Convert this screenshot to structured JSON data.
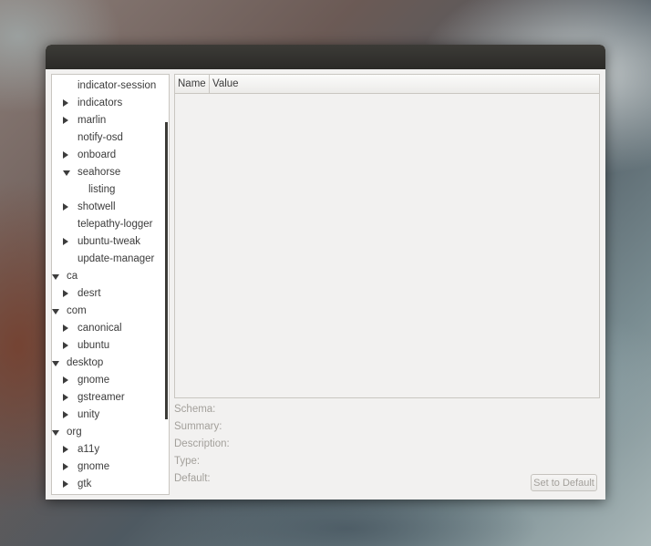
{
  "tree": {
    "items": [
      {
        "label": "indicator-session",
        "level": 2,
        "expander": "none"
      },
      {
        "label": "indicators",
        "level": 2,
        "expander": "collapsed"
      },
      {
        "label": "marlin",
        "level": 2,
        "expander": "collapsed"
      },
      {
        "label": "notify-osd",
        "level": 2,
        "expander": "none"
      },
      {
        "label": "onboard",
        "level": 2,
        "expander": "collapsed"
      },
      {
        "label": "seahorse",
        "level": 2,
        "expander": "expanded"
      },
      {
        "label": "listing",
        "level": 3,
        "expander": "none"
      },
      {
        "label": "shotwell",
        "level": 2,
        "expander": "collapsed"
      },
      {
        "label": "telepathy-logger",
        "level": 2,
        "expander": "none"
      },
      {
        "label": "ubuntu-tweak",
        "level": 2,
        "expander": "collapsed"
      },
      {
        "label": "update-manager",
        "level": 2,
        "expander": "none"
      },
      {
        "label": "ca",
        "level": 1,
        "expander": "expanded"
      },
      {
        "label": "desrt",
        "level": 2,
        "expander": "collapsed"
      },
      {
        "label": "com",
        "level": 1,
        "expander": "expanded"
      },
      {
        "label": "canonical",
        "level": 2,
        "expander": "collapsed"
      },
      {
        "label": "ubuntu",
        "level": 2,
        "expander": "collapsed"
      },
      {
        "label": "desktop",
        "level": 1,
        "expander": "expanded"
      },
      {
        "label": "gnome",
        "level": 2,
        "expander": "collapsed"
      },
      {
        "label": "gstreamer",
        "level": 2,
        "expander": "collapsed"
      },
      {
        "label": "unity",
        "level": 2,
        "expander": "collapsed"
      },
      {
        "label": "org",
        "level": 1,
        "expander": "expanded"
      },
      {
        "label": "a11y",
        "level": 2,
        "expander": "collapsed"
      },
      {
        "label": "gnome",
        "level": 2,
        "expander": "collapsed"
      },
      {
        "label": "gtk",
        "level": 2,
        "expander": "collapsed"
      }
    ]
  },
  "table": {
    "columns": {
      "name": "Name",
      "value": "Value"
    },
    "rows": []
  },
  "details": {
    "schema_label": "Schema:",
    "summary_label": "Summary:",
    "description_label": "Description:",
    "type_label": "Type:",
    "default_label": "Default:"
  },
  "buttons": {
    "set_default": "Set to Default"
  },
  "colors": {
    "titlebar": "#2b2a27",
    "window_bg": "#f2f1f0",
    "text": "#3c3c3c",
    "disabled_text": "#a3a09b"
  }
}
